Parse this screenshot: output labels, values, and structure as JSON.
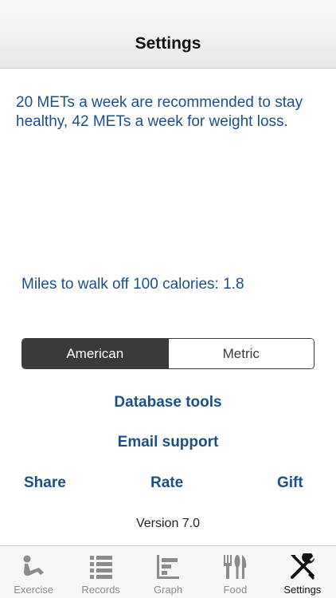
{
  "navbar": {
    "title": "Settings"
  },
  "info": {
    "text": "20 METs a week are recommended to stay healthy, 42 METs a week for weight loss."
  },
  "miles_text": "Miles to walk off 100 calories: 1.8",
  "units": {
    "options": [
      "American",
      "Metric"
    ],
    "selected": "American"
  },
  "actions": {
    "database_tools": "Database tools",
    "email_support": "Email support",
    "share": "Share",
    "rate": "Rate",
    "gift": "Gift"
  },
  "version": "Version 7.0",
  "tabbar": {
    "active": "Settings",
    "inactive_color": "#8c8c8c",
    "active_color": "#111111",
    "items": [
      {
        "label": "Exercise",
        "icon": "exercise-icon"
      },
      {
        "label": "Records",
        "icon": "list-icon"
      },
      {
        "label": "Graph",
        "icon": "graph-icon"
      },
      {
        "label": "Food",
        "icon": "fork-knife-icon"
      },
      {
        "label": "Settings",
        "icon": "wrench-screwdriver-icon"
      }
    ]
  },
  "colors": {
    "accent": "#1d4f86",
    "segment_dark": "#3a3a3a"
  }
}
